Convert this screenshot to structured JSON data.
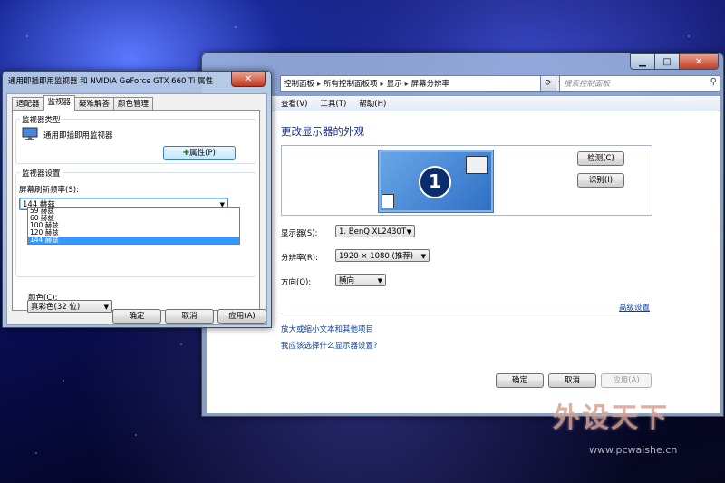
{
  "desktop": {
    "watermark_text": "外设天下",
    "watermark_url": "www.pcwaishe.cn"
  },
  "display_window": {
    "address_crumbs": [
      "控制面板",
      "所有控制面板项",
      "显示",
      "屏幕分辨率"
    ],
    "search_placeholder": "搜索控制面板",
    "menu": [
      "查看(V)",
      "工具(T)",
      "帮助(H)"
    ],
    "heading": "更改显示器的外观",
    "monitor_number": "1",
    "detect_button": "检测(C)",
    "identify_button": "识别(I)",
    "display_label": "显示器(S):",
    "display_value": "1. BenQ XL2430T",
    "resolution_label": "分辨率(R):",
    "resolution_value": "1920 × 1080 (推荐)",
    "orientation_label": "方向(O):",
    "orientation_value": "横向",
    "advanced_link": "高级设置",
    "link_text_size": "放大或缩小文本和其他项目",
    "link_which_settings": "我应该选择什么显示器设置?",
    "ok": "确定",
    "cancel": "取消",
    "apply": "应用(A)"
  },
  "monitor_dialog": {
    "title": "通用即插即用监视器 和 NVIDIA GeForce GTX 660 Ti 属性",
    "close": "✕",
    "tabs": [
      "适配器",
      "监视器",
      "疑难解答",
      "颜色管理"
    ],
    "active_tab_index": 1,
    "monitor_type_group": "监视器类型",
    "monitor_name": "通用即插即用监视器",
    "properties_button": "属性(P)",
    "settings_group": "监视器设置",
    "refresh_label": "屏幕刷新频率(S):",
    "refresh_selected": "144 赫兹",
    "refresh_options": [
      "59 赫兹",
      "60 赫兹",
      "100 赫兹",
      "120 赫兹",
      "144 赫兹"
    ],
    "refresh_highlight_index": 4,
    "color_label": "颜色(C):",
    "color_value": "真彩色(32 位)",
    "ok": "确定",
    "cancel": "取消",
    "apply": "应用(A)"
  }
}
